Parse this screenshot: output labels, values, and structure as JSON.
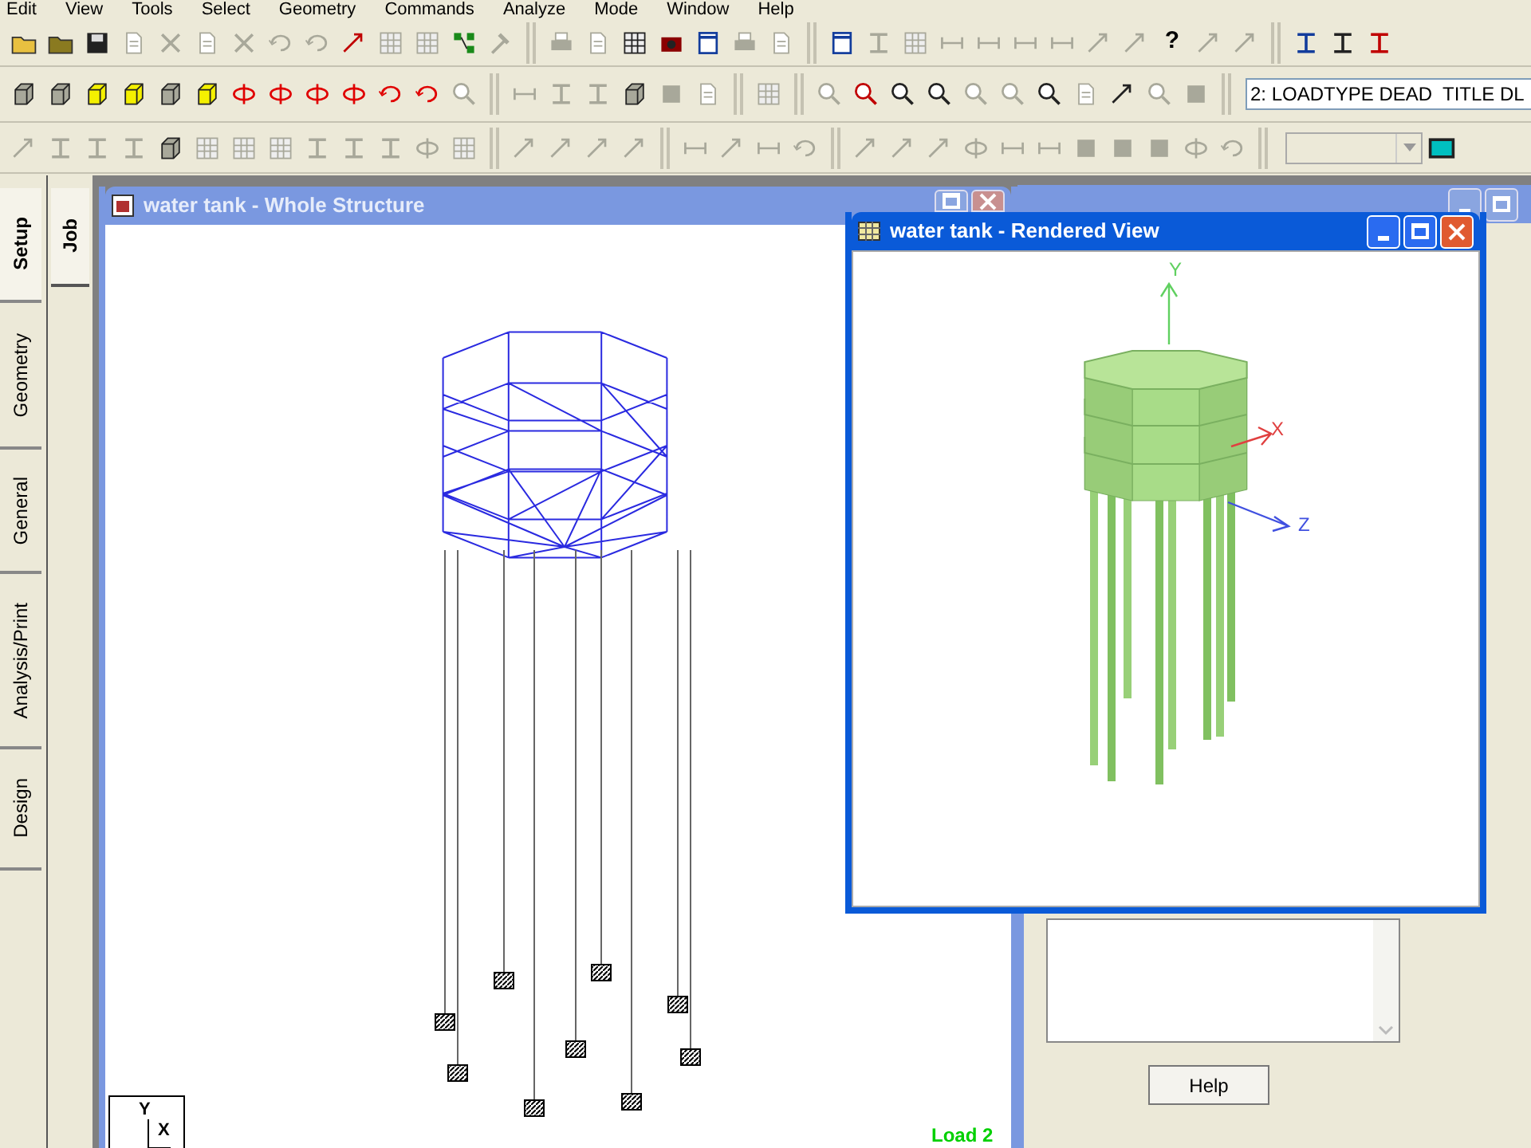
{
  "menu": [
    "Edit",
    "View",
    "Tools",
    "Select",
    "Geometry",
    "Commands",
    "Analyze",
    "Mode",
    "Window",
    "Help"
  ],
  "toolbar": {
    "help_glyph": "?",
    "load_case_dropdown": {
      "value": "2: LOADTYPE DEAD  TITLE DL"
    }
  },
  "side_tabs": [
    {
      "label": "Setup",
      "selected": true
    },
    {
      "label": "Geometry",
      "selected": false
    },
    {
      "label": "General",
      "selected": false
    },
    {
      "label": "Analysis/Print",
      "selected": false
    },
    {
      "label": "Design",
      "selected": false
    }
  ],
  "sub_tabs": [
    {
      "label": "Job",
      "selected": true
    }
  ],
  "whole_structure_window": {
    "title": "water tank - Whole Structure",
    "axis_labels": [
      "Y",
      "X"
    ],
    "load_label": "Load 2",
    "active": false
  },
  "rendered_view_window": {
    "title": "water tank - Rendered View",
    "axis_labels": [
      "Y",
      "X",
      "Z"
    ],
    "active": true
  },
  "side_panel": {
    "help_button": "Help"
  }
}
